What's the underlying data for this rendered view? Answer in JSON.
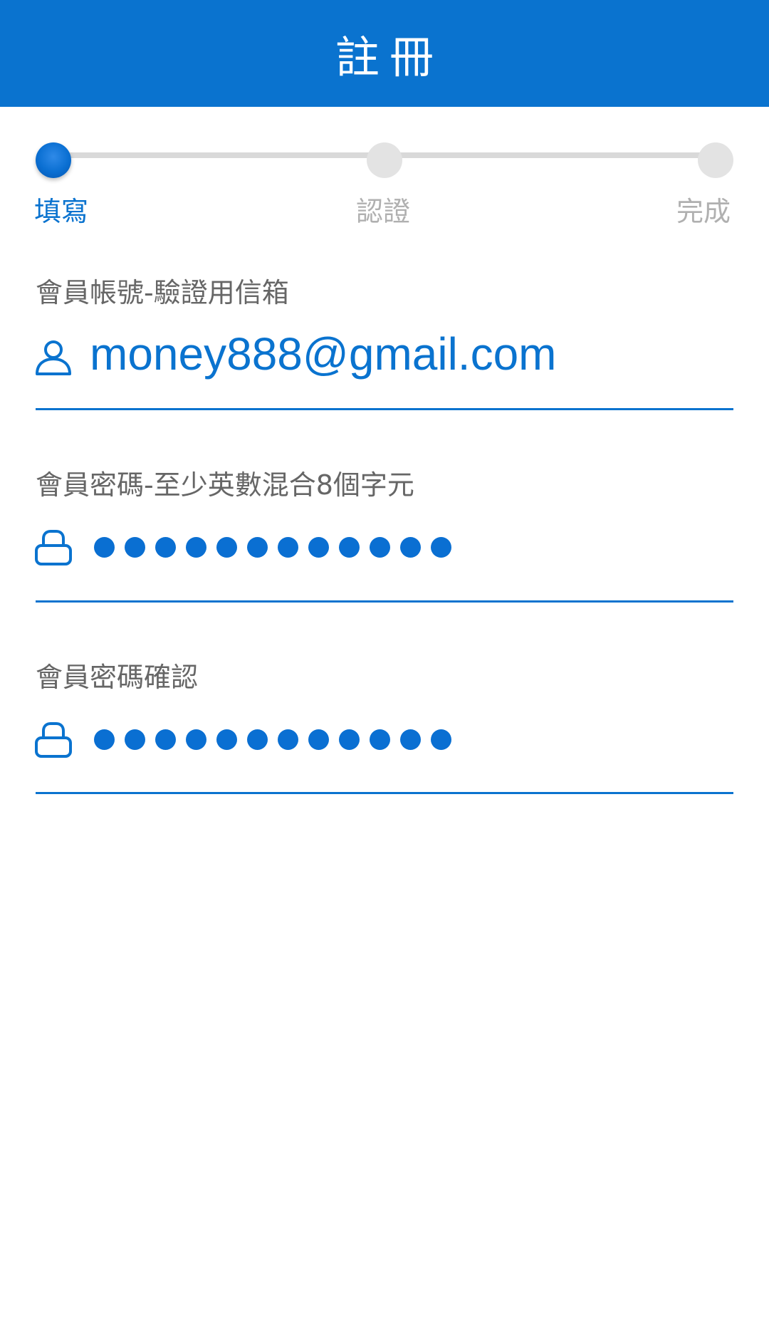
{
  "header": {
    "title": "註冊",
    "background_color": "#0a73cf"
  },
  "stepper": {
    "current_step": 1,
    "steps": [
      {
        "label": "填寫",
        "active": true
      },
      {
        "label": "認證",
        "active": false
      },
      {
        "label": "完成",
        "active": false
      }
    ]
  },
  "form": {
    "account": {
      "label": "會員帳號-驗證用信箱",
      "icon": "user-icon",
      "value": "money888@gmail.com"
    },
    "password": {
      "label": "會員密碼-至少英數混合8個字元",
      "icon": "lock-icon",
      "masked_length": 12
    },
    "password_confirm": {
      "label": "會員密碼確認",
      "icon": "lock-icon",
      "masked_length": 12
    }
  },
  "colors": {
    "accent": "#0a73cf",
    "label": "#666666",
    "inactive": "#b0b0b0"
  }
}
